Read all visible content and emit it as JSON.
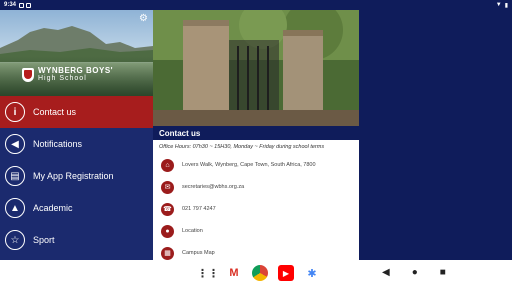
{
  "status": {
    "time": "9:34"
  },
  "drawer": {
    "school_name": "Wynberg Boys'",
    "school_sub": "High School",
    "items": [
      {
        "label": "Contact us",
        "icon": "info-icon",
        "glyph": "i",
        "active": true
      },
      {
        "label": "Notifications",
        "icon": "megaphone-icon",
        "glyph": "◀",
        "active": false
      },
      {
        "label": "My App Registration",
        "icon": "id-card-icon",
        "glyph": "▤",
        "active": false
      },
      {
        "label": "Academic",
        "icon": "graduation-cap-icon",
        "glyph": "▲",
        "active": false
      },
      {
        "label": "Sport",
        "icon": "star-icon",
        "glyph": "☆",
        "active": false
      }
    ]
  },
  "content": {
    "section_title": "Contact us",
    "hours": "Office Hours:  07h30 ~ 15H30, Monday ~ Friday during school terms",
    "rows": [
      {
        "icon": "home-icon",
        "glyph": "⌂",
        "text": "Lovers Walk, Wynberg, Cape Town, South Africa, 7800"
      },
      {
        "icon": "email-icon",
        "glyph": "✉",
        "text": "secretaries@wbhs.org.za"
      },
      {
        "icon": "phone-icon",
        "glyph": "☎",
        "text": "021 797 4247"
      },
      {
        "icon": "location-pin-icon",
        "glyph": "●",
        "text": "Location"
      },
      {
        "icon": "map-icon",
        "glyph": "▦",
        "text": "Campus Map"
      }
    ]
  },
  "colors": {
    "navy": "#0f1c5b",
    "drawer": "#1b2a6e",
    "accent_red": "#a71d1d"
  },
  "navbar": {
    "apps": [
      "app-drawer-icon",
      "gmail-icon",
      "chrome-icon",
      "youtube-icon",
      "photos-icon"
    ],
    "system": [
      "back-icon",
      "home-icon",
      "recents-icon"
    ]
  }
}
